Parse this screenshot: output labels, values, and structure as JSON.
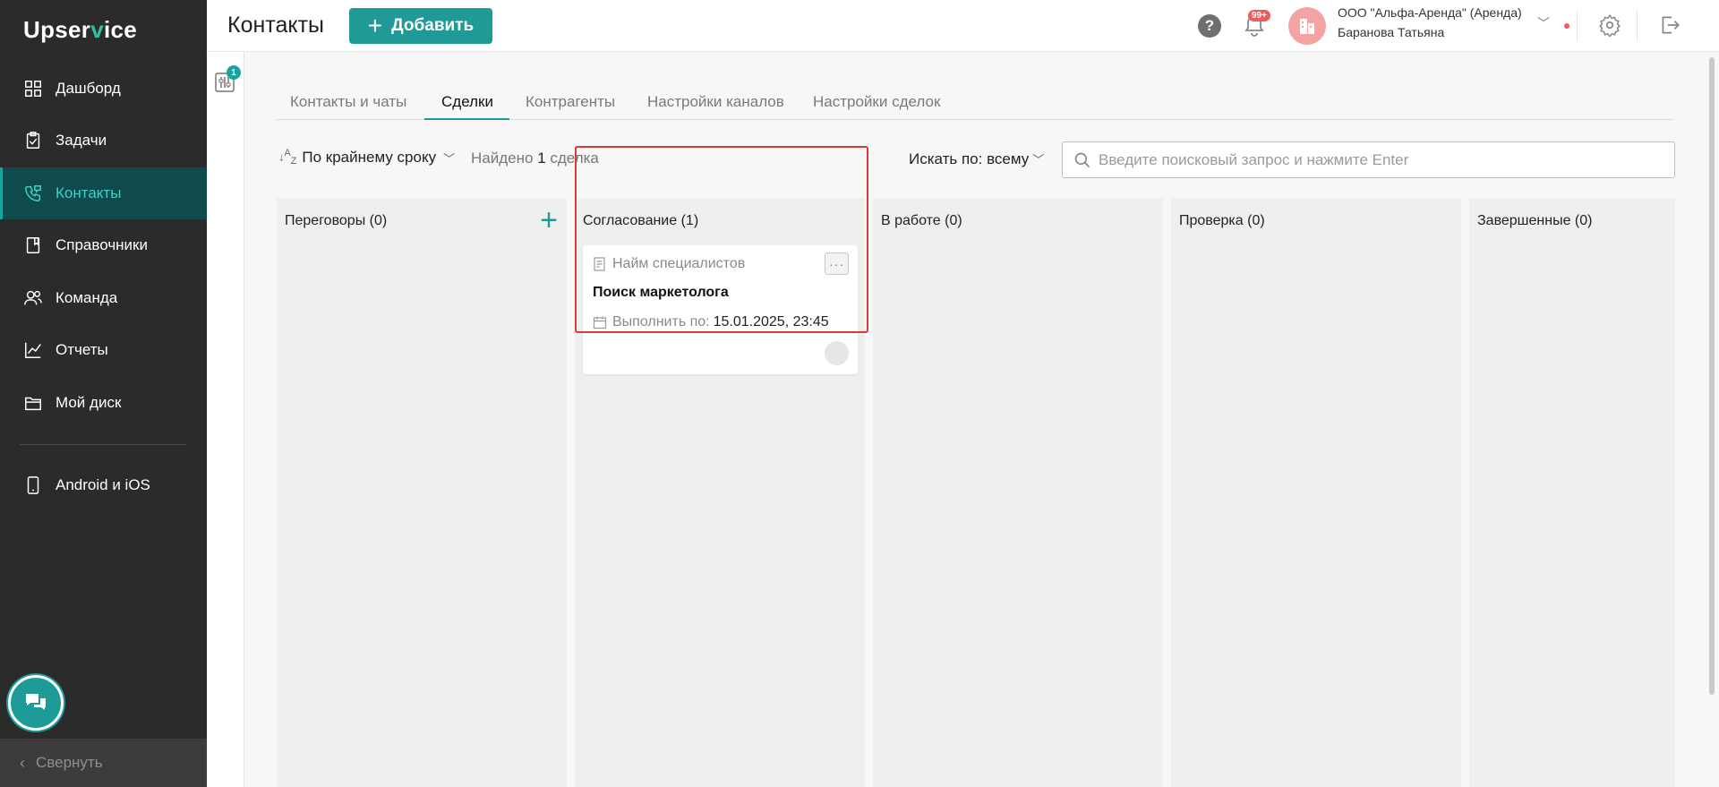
{
  "app": {
    "logo_prefix": "Upser",
    "logo_v": "v",
    "logo_suffix": "ice"
  },
  "sidebar": {
    "items": [
      {
        "label": "Дашборд",
        "icon": "dashboard-icon"
      },
      {
        "label": "Задачи",
        "icon": "tasks-icon"
      },
      {
        "label": "Контакты",
        "icon": "contacts-icon",
        "active": true
      },
      {
        "label": "Справочники",
        "icon": "book-icon"
      },
      {
        "label": "Команда",
        "icon": "team-icon"
      },
      {
        "label": "Отчеты",
        "icon": "chart-icon"
      },
      {
        "label": "Мой диск",
        "icon": "folder-icon"
      },
      {
        "label": "Android и iOS",
        "icon": "phone-icon"
      }
    ],
    "collapse_label": "Свернуть"
  },
  "header": {
    "title": "Контакты",
    "add_label": "Добавить",
    "help": "?",
    "notifications_badge": "99+",
    "org_name": "ООО \"Альфа-Аренда\" (Аренда)",
    "user_name": "Баранова Татьяна"
  },
  "filter": {
    "badge": "1"
  },
  "tabs": [
    {
      "label": "Контакты и чаты"
    },
    {
      "label": "Сделки",
      "active": true
    },
    {
      "label": "Контрагенты"
    },
    {
      "label": "Настройки каналов"
    },
    {
      "label": "Настройки сделок"
    }
  ],
  "toolbar": {
    "sort_icon": "↓",
    "sort_sup": "A",
    "sort_sub": "Z",
    "sort_label": "По крайнему сроку",
    "found_label": "Найдено",
    "found_count": "1",
    "found_suffix": "сделка",
    "search_by": "Искать по: всему",
    "search_placeholder": "Введите поисковый запрос и нажмите Enter"
  },
  "board": {
    "columns": [
      {
        "title": "Переговоры (0)"
      },
      {
        "title": "Согласование (1)"
      },
      {
        "title": "В работе (0)"
      },
      {
        "title": "Проверка (0)"
      },
      {
        "title": "Завершенные (0)"
      }
    ],
    "add_symbol": "+",
    "card": {
      "category": "Найм специалистов",
      "title": "Поиск маркетолога",
      "due_label": "Выполнить по:",
      "due_date": "15.01.2025, 23:45",
      "more": "···"
    }
  },
  "colors": {
    "accent": "#1f9a96",
    "sidebar_bg": "#2b2b2b",
    "active_nav": "#0f4a4c",
    "highlight": "#d93a3a"
  }
}
